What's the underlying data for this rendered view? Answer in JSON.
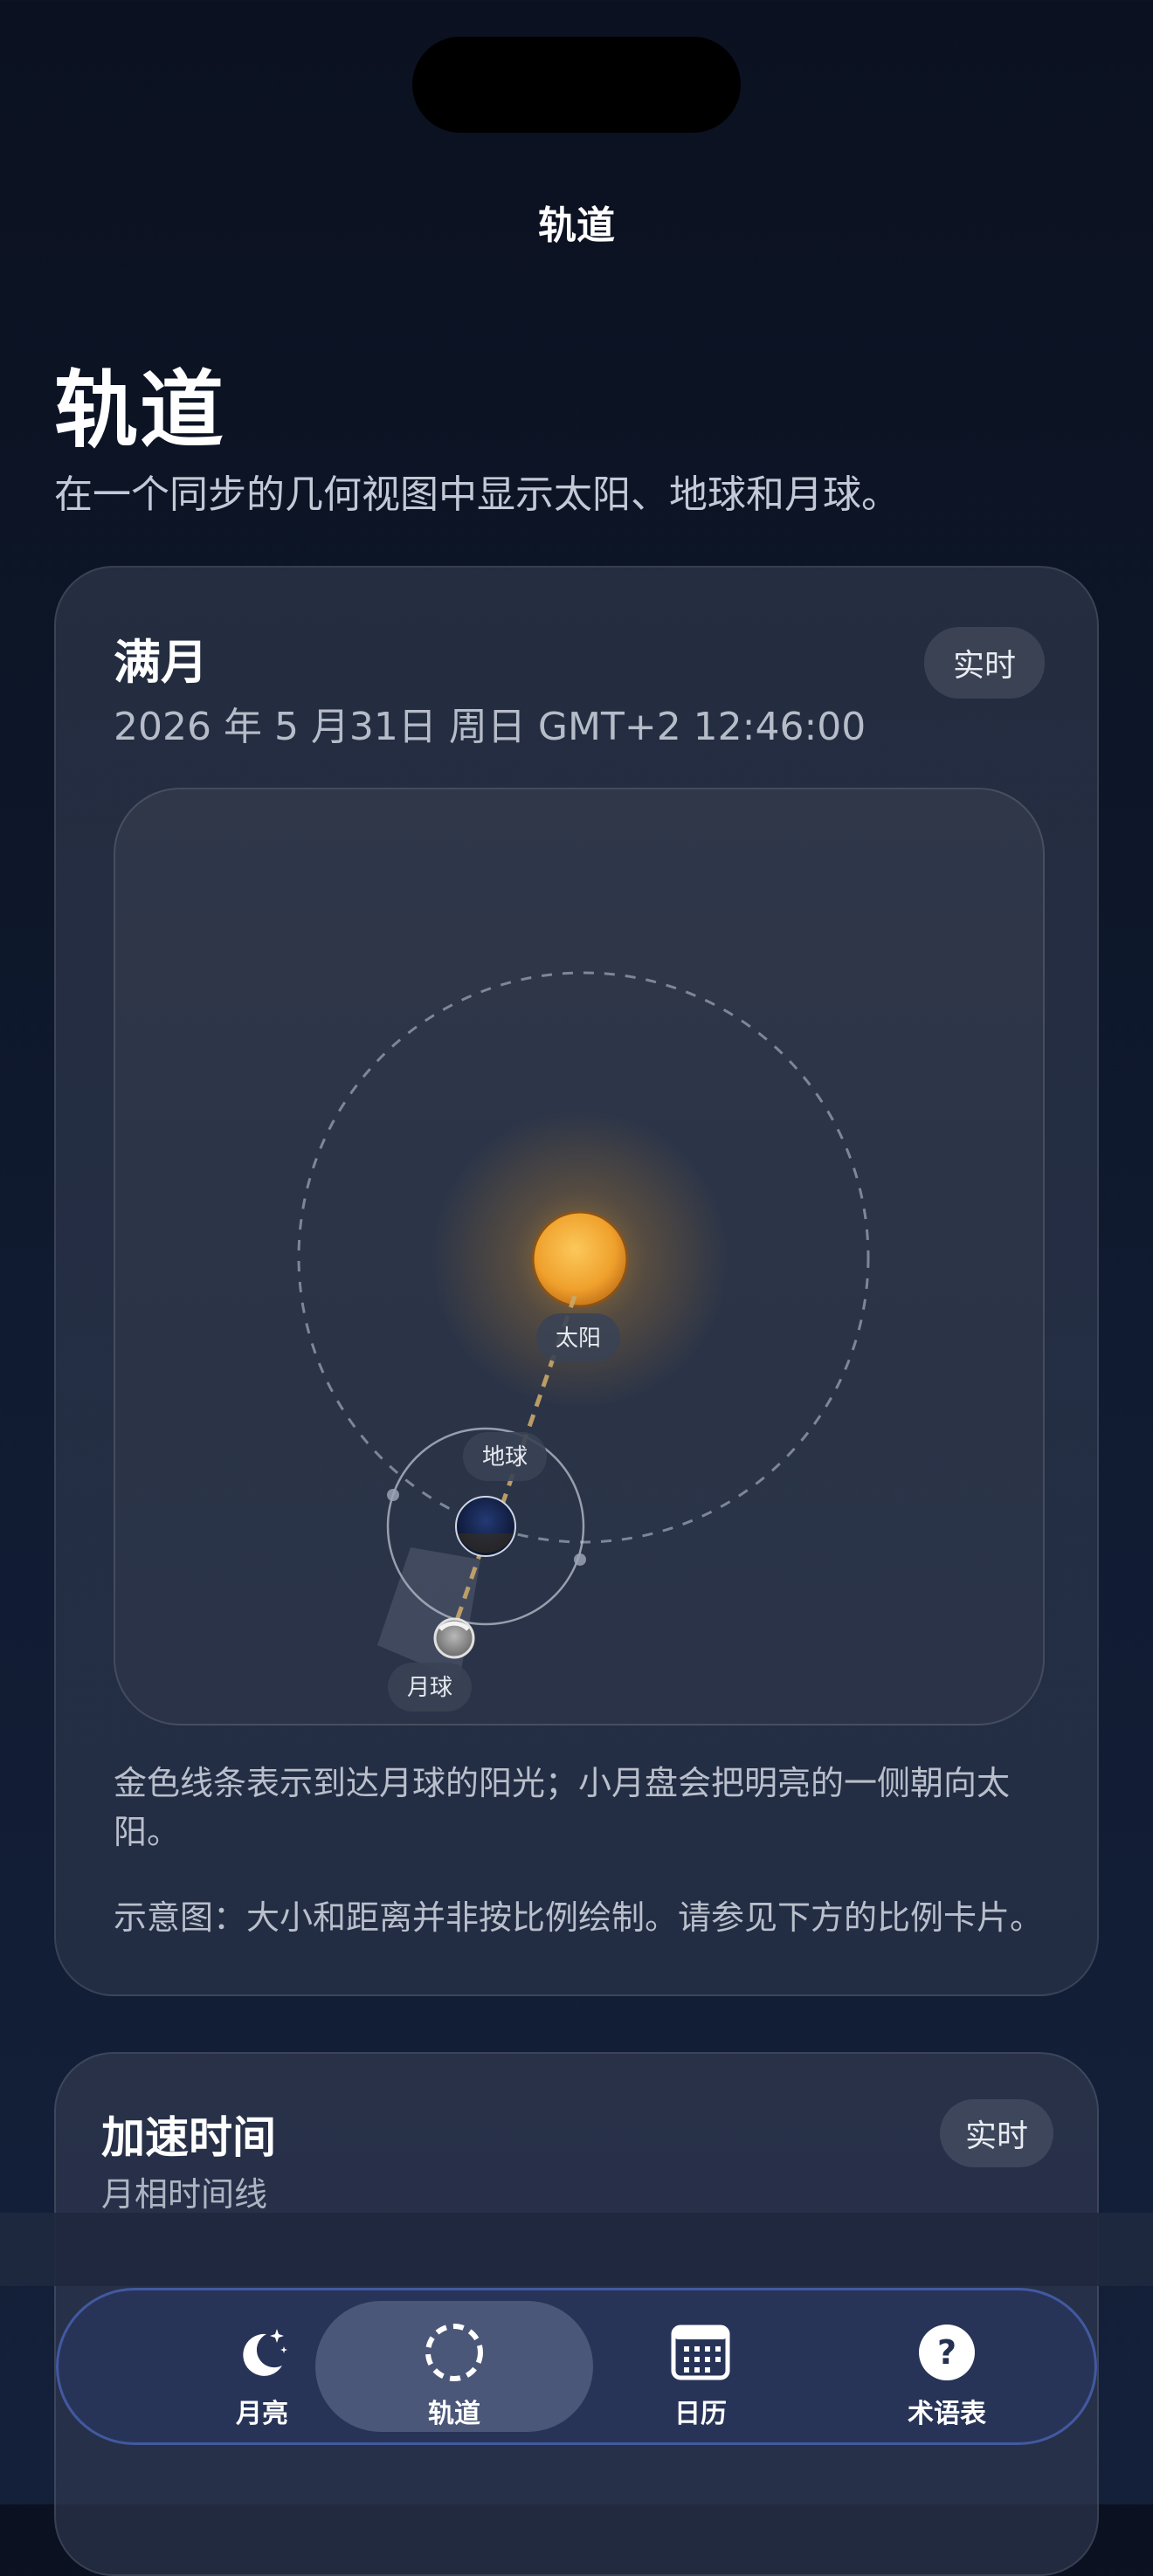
{
  "nav": {
    "title": "轨道"
  },
  "header": {
    "title": "轨道",
    "subtitle": "在一个同步的几何视图中显示太阳、地球和月球。"
  },
  "orbit_card": {
    "phase": "满月",
    "datetime": "2026 年 5 月31日 周日 GMT+2 12:46:00",
    "live_label": "实时",
    "bodies": {
      "sun": "太阳",
      "earth": "地球",
      "moon": "月球"
    },
    "caption": "金色线条表示到达月球的阳光；小月盘会把明亮的一侧朝向太阳。",
    "note": "示意图：大小和距离并非按比例绘制。请参见下方的比例卡片。"
  },
  "timelapse_card": {
    "title": "加速时间",
    "subtitle": "月相时间线",
    "live_label": "实时"
  },
  "tabbar": {
    "items": [
      {
        "label": "月亮",
        "icon": "moon-stars-icon",
        "active": false
      },
      {
        "label": "轨道",
        "icon": "orbit-icon",
        "active": true
      },
      {
        "label": "日历",
        "icon": "calendar-icon",
        "active": false
      },
      {
        "label": "术语表",
        "icon": "question-icon",
        "active": false
      }
    ]
  },
  "colors": {
    "accent_sun": "#f2a531",
    "sunlight_line": "#c9a86a",
    "tab_border": "#5a78dc"
  }
}
